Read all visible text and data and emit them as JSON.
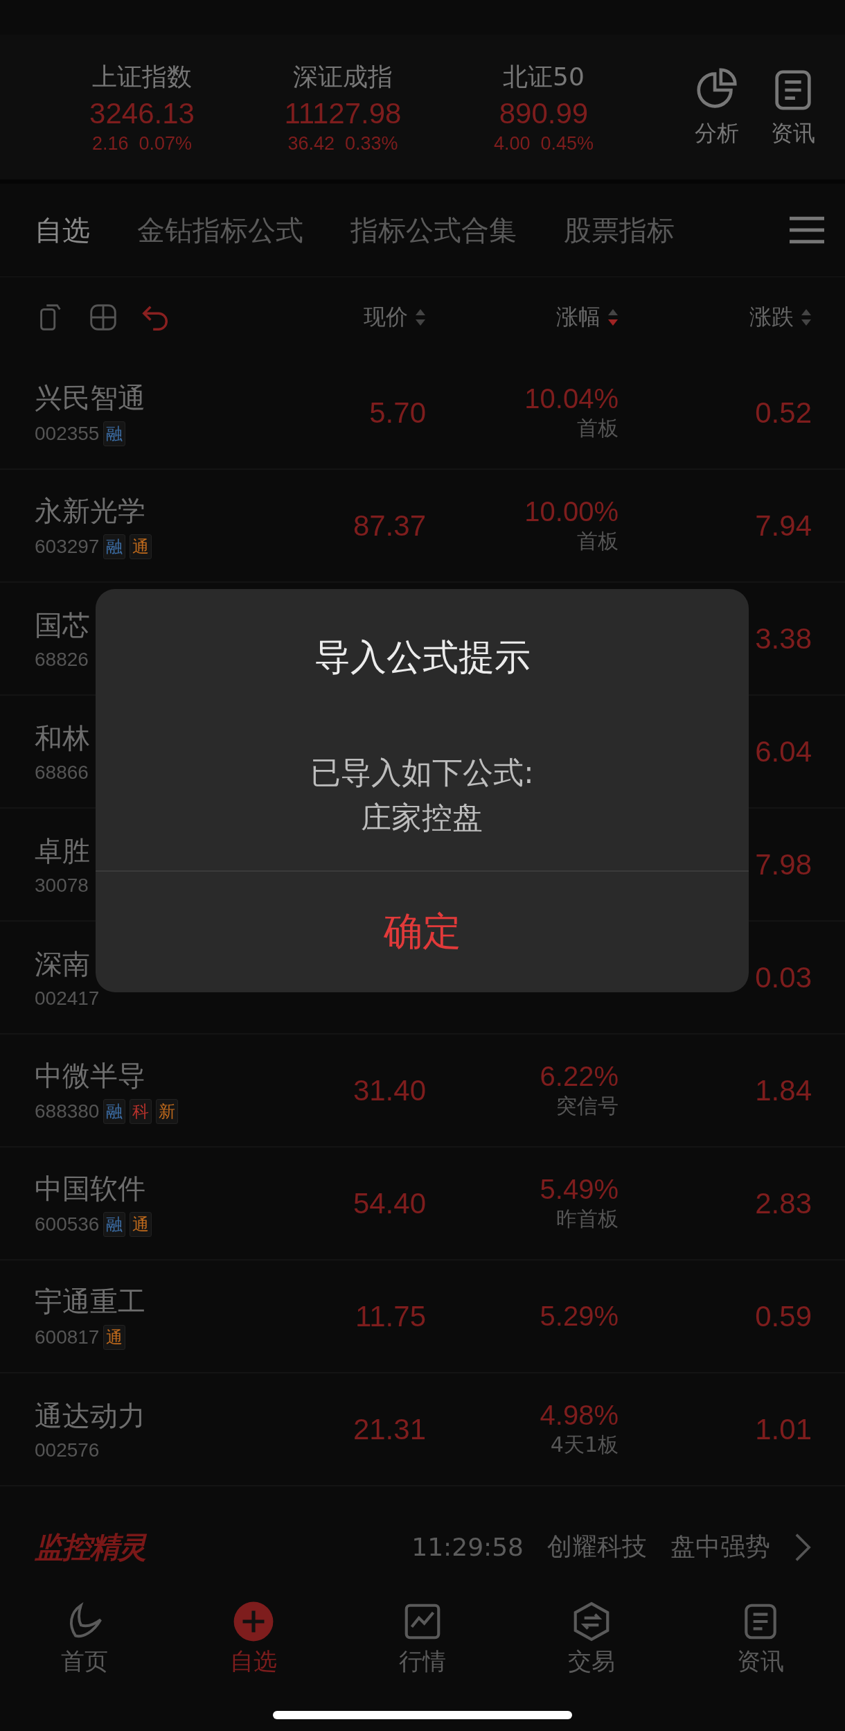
{
  "indices": [
    {
      "name": "上证指数",
      "value": "3246.13",
      "change": "2.16",
      "percent": "0.07%"
    },
    {
      "name": "深证成指",
      "value": "11127.98",
      "change": "36.42",
      "percent": "0.33%"
    },
    {
      "name": "北证50",
      "value": "890.99",
      "change": "4.00",
      "percent": "0.45%"
    }
  ],
  "header_actions": [
    {
      "kind": "pie",
      "label": "分析"
    },
    {
      "kind": "news",
      "label": "资讯"
    }
  ],
  "tabs": [
    {
      "label": "自选",
      "selected": true
    },
    {
      "label": "金钻指标公式",
      "selected": false
    },
    {
      "label": "指标公式合集",
      "selected": false
    },
    {
      "label": "股票指标",
      "selected": false
    }
  ],
  "toolbar": [
    {
      "kind": "copy"
    },
    {
      "kind": "grid"
    },
    {
      "kind": "undo"
    }
  ],
  "columns": [
    {
      "label": "现价",
      "sorted": false
    },
    {
      "label": "涨幅",
      "sorted": true
    },
    {
      "label": "涨跌",
      "sorted": false
    }
  ],
  "rows": [
    {
      "name": "兴民智通",
      "code": "002355",
      "tags": [
        {
          "text": "融",
          "color": "#3d6fa8"
        }
      ],
      "price": "5.70",
      "percent": "10.04%",
      "note": "首板",
      "change": "0.52"
    },
    {
      "name": "永新光学",
      "code": "603297",
      "tags": [
        {
          "text": "融",
          "color": "#3d6fa8"
        },
        {
          "text": "通",
          "color": "#c06a1c"
        }
      ],
      "price": "87.37",
      "percent": "10.00%",
      "note": "首板",
      "change": "7.94"
    },
    {
      "name": "国芯",
      "code": "68826",
      "change": "3.38"
    },
    {
      "name": "和林",
      "code": "68866",
      "change": "6.04"
    },
    {
      "name": "卓胜",
      "code": "30078",
      "change": "7.98"
    },
    {
      "name": "深南",
      "code": "002417",
      "change": "0.03"
    },
    {
      "name": "中微半导",
      "code": "688380",
      "tags": [
        {
          "text": "融",
          "color": "#3d6fa8"
        },
        {
          "text": "科",
          "color": "#b8322c"
        },
        {
          "text": "新",
          "color": "#c06a1c"
        }
      ],
      "price": "31.40",
      "percent": "6.22%",
      "note": "突信号",
      "change": "1.84"
    },
    {
      "name": "中国软件",
      "code": "600536",
      "tags": [
        {
          "text": "融",
          "color": "#3d6fa8"
        },
        {
          "text": "通",
          "color": "#c06a1c"
        }
      ],
      "price": "54.40",
      "percent": "5.49%",
      "note": "昨首板",
      "change": "2.83"
    },
    {
      "name": "宇通重工",
      "code": "600817",
      "tags": [
        {
          "text": "通",
          "color": "#c06a1c"
        }
      ],
      "price": "11.75",
      "percent": "5.29%",
      "change": "0.59"
    },
    {
      "name": "通达动力",
      "code": "002576",
      "price": "21.31",
      "percent": "4.98%",
      "note": "4天1板",
      "change": "1.01"
    }
  ],
  "ticker": {
    "brand": "监控精灵",
    "time": "11:29:58",
    "stock": "创耀科技",
    "signal": "盘中强势"
  },
  "nav": [
    {
      "kind": "home",
      "label": "首页",
      "selected": false
    },
    {
      "kind": "add",
      "label": "自选",
      "selected": true
    },
    {
      "kind": "chart",
      "label": "行情",
      "selected": false
    },
    {
      "kind": "trade",
      "label": "交易",
      "selected": false
    },
    {
      "kind": "news",
      "label": "资讯",
      "selected": false
    }
  ],
  "dialog": {
    "title": "导入公式提示",
    "message": "已导入如下公式:",
    "formula": "庄家控盘",
    "button": "确定"
  }
}
